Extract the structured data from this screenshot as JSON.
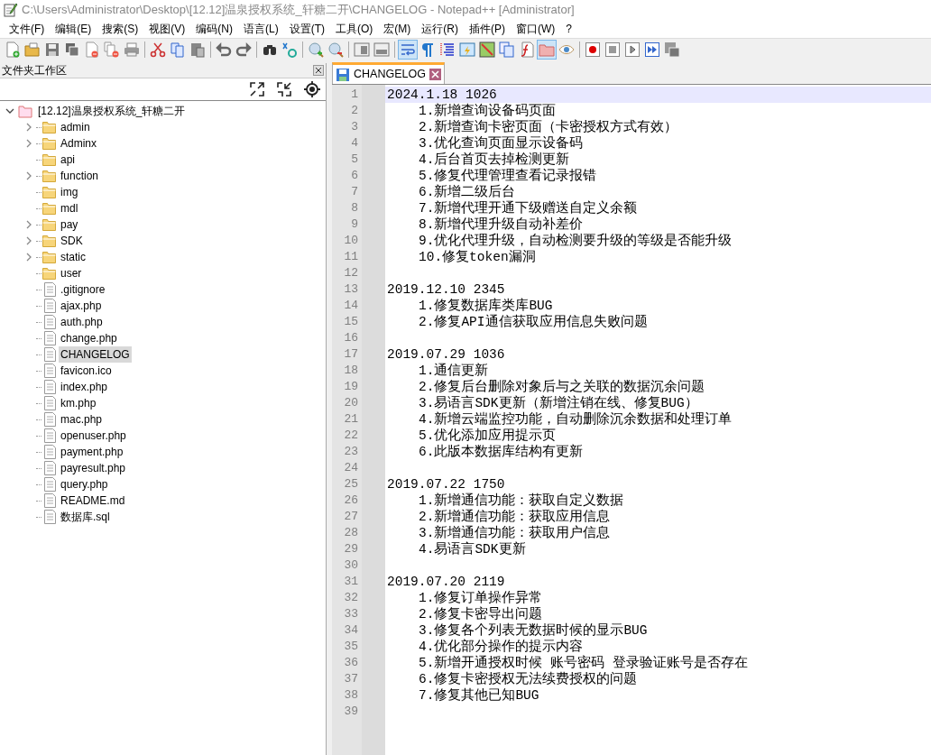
{
  "window": {
    "title": "C:\\Users\\Administrator\\Desktop\\[12.12]温泉授权系统_轩糖二开\\CHANGELOG - Notepad++ [Administrator]"
  },
  "menu": [
    "文件(F)",
    "编辑(E)",
    "搜索(S)",
    "视图(V)",
    "编码(N)",
    "语言(L)",
    "设置(T)",
    "工具(O)",
    "宏(M)",
    "运行(R)",
    "插件(P)",
    "窗口(W)",
    "?"
  ],
  "toolbar": [
    {
      "kind": "new",
      "pressed": false
    },
    {
      "kind": "open",
      "pressed": false
    },
    {
      "kind": "save",
      "pressed": false
    },
    {
      "kind": "saveall",
      "pressed": false
    },
    {
      "kind": "close",
      "pressed": false
    },
    {
      "kind": "closeall",
      "pressed": false
    },
    {
      "kind": "print",
      "pressed": false
    },
    {
      "kind": "sep"
    },
    {
      "kind": "cut",
      "pressed": false
    },
    {
      "kind": "copy",
      "pressed": false
    },
    {
      "kind": "paste",
      "pressed": false
    },
    {
      "kind": "sep"
    },
    {
      "kind": "undo",
      "pressed": false
    },
    {
      "kind": "redo",
      "pressed": false
    },
    {
      "kind": "sep"
    },
    {
      "kind": "find",
      "pressed": false
    },
    {
      "kind": "replace",
      "pressed": false
    },
    {
      "kind": "sep"
    },
    {
      "kind": "zoomin",
      "pressed": false
    },
    {
      "kind": "zoomout",
      "pressed": false
    },
    {
      "kind": "sep"
    },
    {
      "kind": "syncv",
      "pressed": false
    },
    {
      "kind": "synch",
      "pressed": false
    },
    {
      "kind": "sep"
    },
    {
      "kind": "wrap",
      "pressed": true
    },
    {
      "kind": "pilcrow",
      "pressed": false
    },
    {
      "kind": "indent",
      "pressed": false
    },
    {
      "kind": "lang",
      "pressed": false
    },
    {
      "kind": "map",
      "pressed": false
    },
    {
      "kind": "doclist",
      "pressed": false
    },
    {
      "kind": "func",
      "pressed": false
    },
    {
      "kind": "folder",
      "pressed": true
    },
    {
      "kind": "eye",
      "pressed": false
    },
    {
      "kind": "sep"
    },
    {
      "kind": "record",
      "pressed": false
    },
    {
      "kind": "stop",
      "pressed": false
    },
    {
      "kind": "play",
      "pressed": false
    },
    {
      "kind": "playmulti",
      "pressed": false
    },
    {
      "kind": "savemacro",
      "pressed": false
    }
  ],
  "sidebar": {
    "title": "文件夹工作区",
    "root": {
      "label": "[12.12]温泉授权系统_轩糖二开",
      "expanded": true,
      "children": [
        {
          "label": "admin",
          "kind": "folder",
          "expandable": true,
          "selected": false
        },
        {
          "label": "Adminx",
          "kind": "folder",
          "expandable": true,
          "selected": false
        },
        {
          "label": "api",
          "kind": "folder",
          "expandable": false,
          "selected": false
        },
        {
          "label": "function",
          "kind": "folder",
          "expandable": true,
          "selected": false
        },
        {
          "label": "img",
          "kind": "folder",
          "expandable": false,
          "selected": false
        },
        {
          "label": "mdl",
          "kind": "folder",
          "expandable": false,
          "selected": false
        },
        {
          "label": "pay",
          "kind": "folder",
          "expandable": true,
          "selected": false
        },
        {
          "label": "SDK",
          "kind": "folder",
          "expandable": true,
          "selected": false
        },
        {
          "label": "static",
          "kind": "folder",
          "expandable": true,
          "selected": false
        },
        {
          "label": "user",
          "kind": "folder",
          "expandable": false,
          "selected": false
        },
        {
          "label": ".gitignore",
          "kind": "file",
          "expandable": false,
          "selected": false
        },
        {
          "label": "ajax.php",
          "kind": "file",
          "expandable": false,
          "selected": false
        },
        {
          "label": "auth.php",
          "kind": "file",
          "expandable": false,
          "selected": false
        },
        {
          "label": "change.php",
          "kind": "file",
          "expandable": false,
          "selected": false
        },
        {
          "label": "CHANGELOG",
          "kind": "file",
          "expandable": false,
          "selected": true
        },
        {
          "label": "favicon.ico",
          "kind": "file",
          "expandable": false,
          "selected": false
        },
        {
          "label": "index.php",
          "kind": "file",
          "expandable": false,
          "selected": false
        },
        {
          "label": "km.php",
          "kind": "file",
          "expandable": false,
          "selected": false
        },
        {
          "label": "mac.php",
          "kind": "file",
          "expandable": false,
          "selected": false
        },
        {
          "label": "openuser.php",
          "kind": "file",
          "expandable": false,
          "selected": false
        },
        {
          "label": "payment.php",
          "kind": "file",
          "expandable": false,
          "selected": false
        },
        {
          "label": "payresult.php",
          "kind": "file",
          "expandable": false,
          "selected": false
        },
        {
          "label": "query.php",
          "kind": "file",
          "expandable": false,
          "selected": false
        },
        {
          "label": "README.md",
          "kind": "file",
          "expandable": false,
          "selected": false
        },
        {
          "label": "数据库.sql",
          "kind": "file",
          "expandable": false,
          "selected": false
        }
      ]
    }
  },
  "tabs": [
    {
      "label": "CHANGELOG",
      "selected": true
    }
  ],
  "lines": [
    {
      "number": "1",
      "kind": "heading",
      "text": "2024.1.18 1026",
      "current": true
    },
    {
      "number": "2",
      "kind": "item",
      "text": "1.新增查询设备码页面",
      "current": false
    },
    {
      "number": "3",
      "kind": "item",
      "text": "2.新增查询卡密页面（卡密授权方式有效）",
      "current": false
    },
    {
      "number": "4",
      "kind": "item",
      "text": "3.优化查询页面显示设备码",
      "current": false
    },
    {
      "number": "5",
      "kind": "item",
      "text": "4.后台首页去掉检测更新",
      "current": false
    },
    {
      "number": "6",
      "kind": "item",
      "text": "5.修复代理管理查看记录报错",
      "current": false
    },
    {
      "number": "7",
      "kind": "item",
      "text": "6.新增二级后台",
      "current": false
    },
    {
      "number": "8",
      "kind": "item",
      "text": "7.新增代理开通下级赠送自定义余额",
      "current": false
    },
    {
      "number": "9",
      "kind": "item",
      "text": "8.新增代理升级自动补差价",
      "current": false
    },
    {
      "number": "10",
      "kind": "item",
      "text": "9.优化代理升级，自动检测要升级的等级是否能升级",
      "current": false
    },
    {
      "number": "11",
      "kind": "item",
      "text": "10.修复token漏洞",
      "current": false
    },
    {
      "number": "12",
      "kind": "blank",
      "current": false
    },
    {
      "number": "13",
      "kind": "heading",
      "text": "2019.12.10 2345",
      "current": false
    },
    {
      "number": "14",
      "kind": "item",
      "text": "1.修复数据库类库BUG",
      "current": false
    },
    {
      "number": "15",
      "kind": "item",
      "text": "2.修复API通信获取应用信息失败问题",
      "current": false
    },
    {
      "number": "16",
      "kind": "blank",
      "current": false
    },
    {
      "number": "17",
      "kind": "heading",
      "text": "2019.07.29 1036",
      "current": false
    },
    {
      "number": "18",
      "kind": "item",
      "text": "1.通信更新",
      "current": false
    },
    {
      "number": "19",
      "kind": "item",
      "text": "2.修复后台删除对象后与之关联的数据沉余问题",
      "current": false
    },
    {
      "number": "20",
      "kind": "item",
      "text": "3.易语言SDK更新（新增注销在线、修复BUG）",
      "current": false
    },
    {
      "number": "21",
      "kind": "item",
      "text": "4.新增云端监控功能，自动删除沉余数据和处理订单",
      "current": false
    },
    {
      "number": "22",
      "kind": "item",
      "text": "5.优化添加应用提示页",
      "current": false
    },
    {
      "number": "23",
      "kind": "item",
      "text": "6.此版本数据库结构有更新",
      "current": false
    },
    {
      "number": "24",
      "kind": "blank",
      "current": false
    },
    {
      "number": "25",
      "kind": "heading",
      "text": "2019.07.22 1750",
      "current": false
    },
    {
      "number": "26",
      "kind": "item",
      "text": "1.新增通信功能：获取自定义数据",
      "current": false
    },
    {
      "number": "27",
      "kind": "item",
      "text": "2.新增通信功能：获取应用信息",
      "current": false
    },
    {
      "number": "28",
      "kind": "item",
      "text": "3.新增通信功能：获取用户信息",
      "current": false
    },
    {
      "number": "29",
      "kind": "item",
      "text": "4.易语言SDK更新",
      "current": false
    },
    {
      "number": "30",
      "kind": "blank",
      "current": false
    },
    {
      "number": "31",
      "kind": "heading",
      "text": "2019.07.20 2119",
      "current": false
    },
    {
      "number": "32",
      "kind": "item",
      "text": "1.修复订单操作异常",
      "current": false
    },
    {
      "number": "33",
      "kind": "item",
      "text": "2.修复卡密导出问题",
      "current": false
    },
    {
      "number": "34",
      "kind": "item",
      "text": "3.修复各个列表无数据时候的显示BUG",
      "current": false
    },
    {
      "number": "35",
      "kind": "item",
      "text": "4.优化部分操作的提示内容",
      "current": false
    },
    {
      "number": "36",
      "kind": "item",
      "text": "5.新增开通授权时候 账号密码 登录验证账号是否存在",
      "current": false
    },
    {
      "number": "37",
      "kind": "item",
      "text": "6.修复卡密授权无法续费授权的问题",
      "current": false
    },
    {
      "number": "38",
      "kind": "item",
      "text": "7.修复其他已知BUG",
      "current": false
    },
    {
      "number": "39",
      "kind": "blank",
      "current": false
    }
  ]
}
